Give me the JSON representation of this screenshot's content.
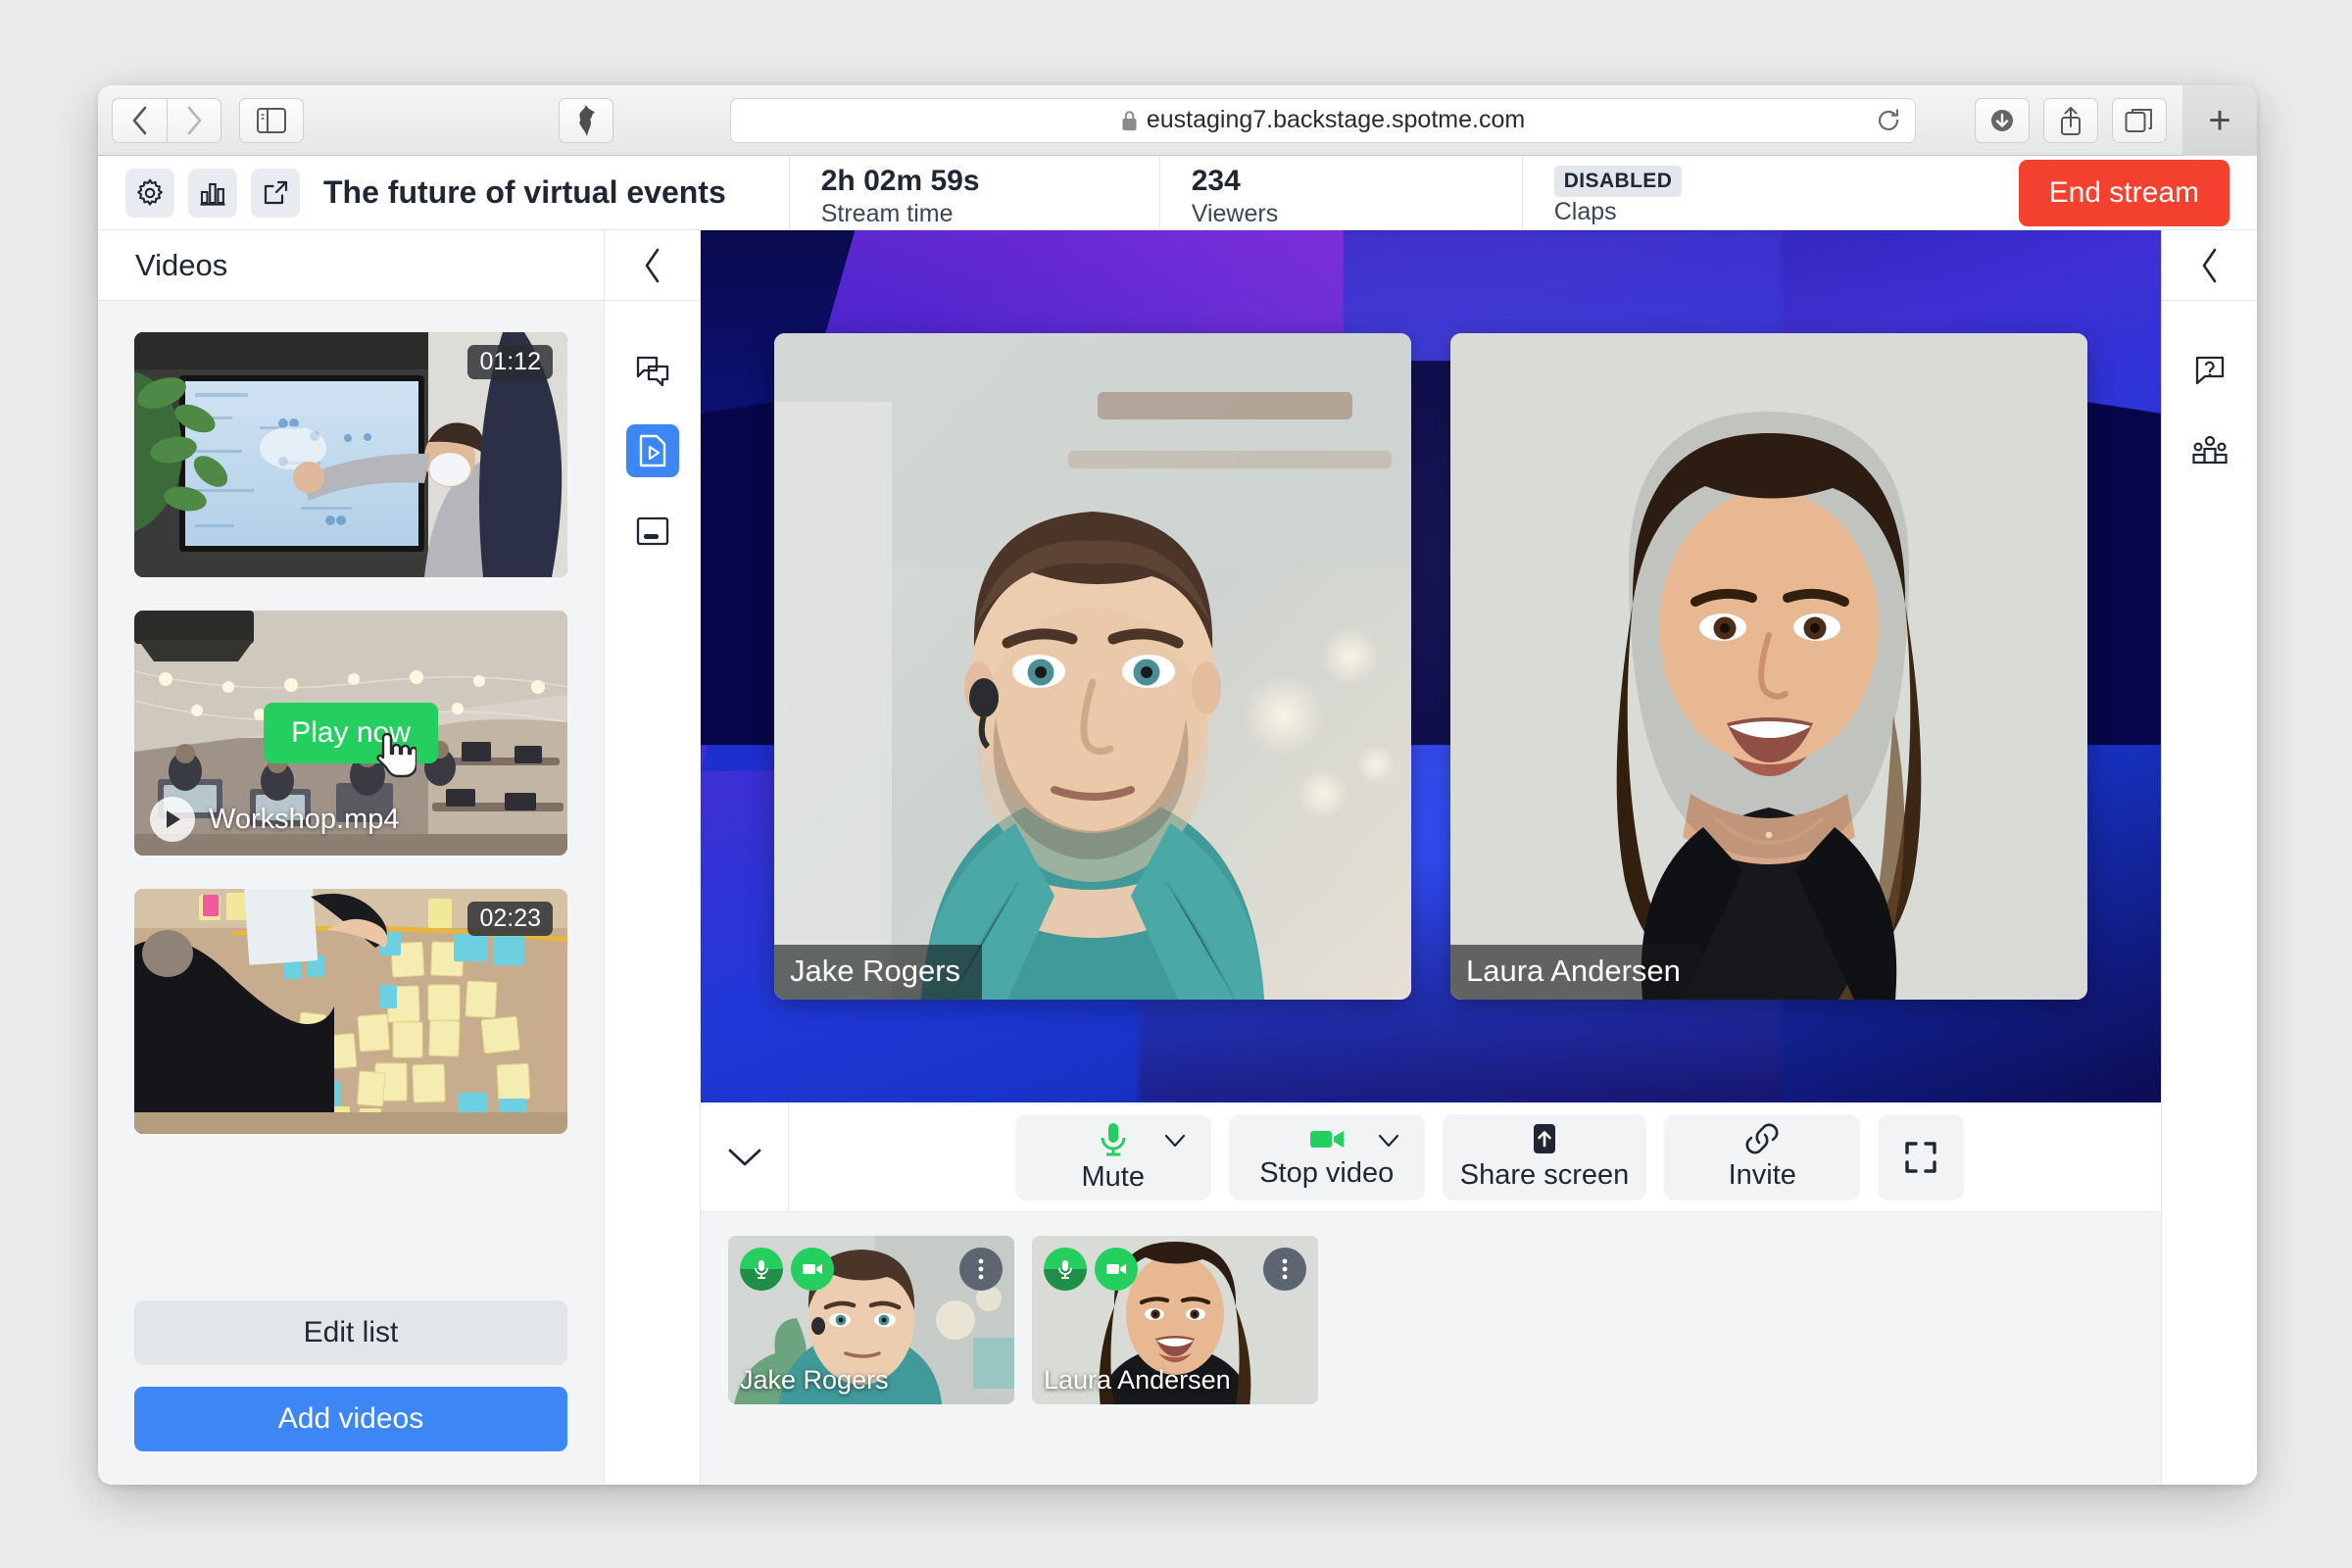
{
  "browser": {
    "url": "eustaging7.backstage.spotme.com",
    "back_label": "Back",
    "forward_label": "Forward",
    "sidebar_label": "Show sidebar",
    "shield_label": "Privacy report",
    "reload_label": "Reload",
    "downloads_label": "Downloads",
    "share_label": "Share",
    "tabs_label": "Show tab overview",
    "new_tab_label": "+"
  },
  "header": {
    "settings_icon": "gear-icon",
    "analytics_icon": "bar-chart-icon",
    "open_external_icon": "external-link-icon",
    "title": "The future of virtual events",
    "stats": [
      {
        "value": "2h 02m 59s",
        "label": "Stream time"
      },
      {
        "value": "234",
        "label": "Viewers"
      }
    ],
    "claps": {
      "badge": "DISABLED",
      "label": "Claps"
    },
    "end_stream": "End stream"
  },
  "videos_panel": {
    "title": "Videos",
    "items": [
      {
        "duration": "01:12",
        "name": "",
        "hover": false
      },
      {
        "duration": "",
        "name": "Workshop.mp4",
        "hover": true,
        "play_label": "Play now"
      },
      {
        "duration": "02:23",
        "name": "",
        "hover": false
      }
    ],
    "edit_list": "Edit list",
    "add_videos": "Add videos"
  },
  "left_rail": {
    "collapse_icon": "chevron-left-icon",
    "items": [
      {
        "icon": "chat-bubbles-icon",
        "active": false
      },
      {
        "icon": "video-file-icon",
        "active": true
      },
      {
        "icon": "lower-third-icon",
        "active": false
      }
    ]
  },
  "right_rail": {
    "collapse_icon": "chevron-left-icon",
    "items": [
      {
        "icon": "question-bubble-icon"
      },
      {
        "icon": "people-podium-icon"
      }
    ]
  },
  "stage": {
    "tiles": [
      {
        "name": "Jake Rogers"
      },
      {
        "name": "Laura Andersen"
      }
    ]
  },
  "controls": {
    "collapse_icon": "chevron-down-icon",
    "buttons": [
      {
        "label": "Mute",
        "icon": "microphone-icon",
        "has_caret": true,
        "accent": "#25cf5f"
      },
      {
        "label": "Stop video",
        "icon": "camera-icon",
        "has_caret": true,
        "accent": "#25cf5f"
      },
      {
        "label": "Share screen",
        "icon": "share-screen-icon",
        "has_caret": false,
        "accent": "#1f2733"
      },
      {
        "label": "Invite",
        "icon": "link-icon",
        "has_caret": false,
        "accent": "#1f2733"
      }
    ],
    "fullscreen_icon": "fullscreen-icon"
  },
  "participants": [
    {
      "name": "Jake Rogers",
      "mic_icon": "microphone-icon",
      "cam_icon": "camera-icon",
      "more_icon": "more-vertical-icon"
    },
    {
      "name": "Laura Andersen",
      "mic_icon": "microphone-icon",
      "cam_icon": "camera-icon",
      "more_icon": "more-vertical-icon"
    }
  ],
  "colors": {
    "accent_blue": "#3d86f5",
    "danger_red": "#f4402e",
    "green": "#25cf5f",
    "text_dark": "#1f2733"
  }
}
